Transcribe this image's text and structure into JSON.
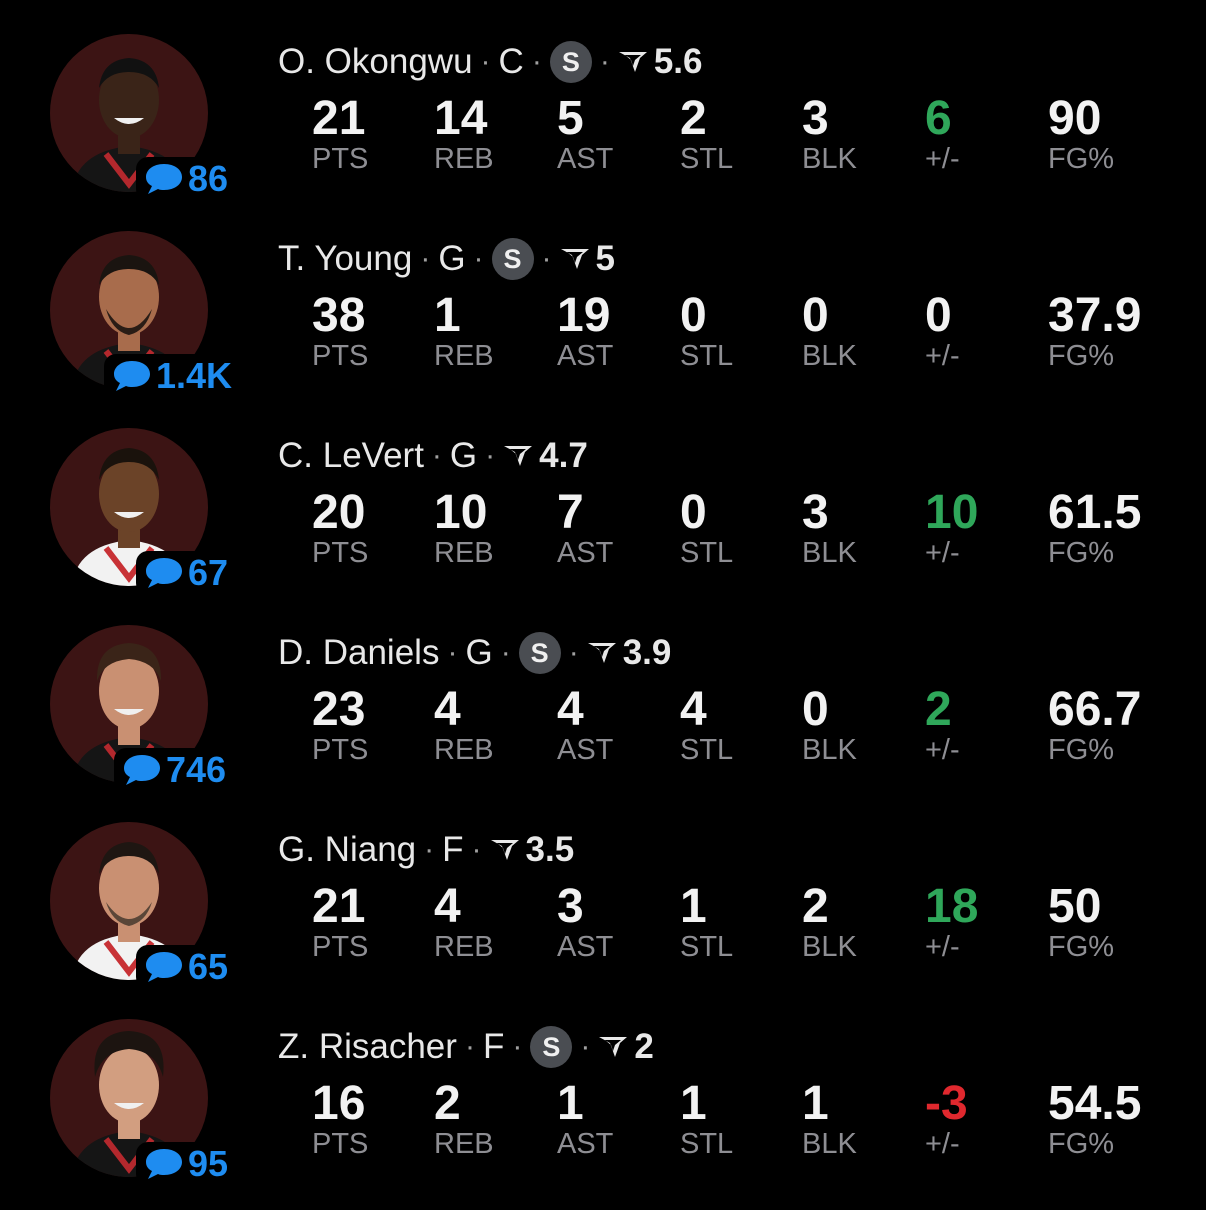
{
  "colors": {
    "background": "#000000",
    "comment_blue": "#1e8cf0",
    "plus_minus_positive": "#2fa75a",
    "plus_minus_negative": "#e0282e",
    "label_gray": "#8e8e93",
    "avatar_bg": "#3c1414",
    "starter_badge_bg": "#4a4d52"
  },
  "icons": {
    "comment": "chat-bubble-icon",
    "starter": "starter-badge-icon",
    "rating": "rating-logo-icon",
    "avatar": "player-headshot"
  },
  "separator": "·",
  "labels": {
    "pts": "PTS",
    "reb": "REB",
    "ast": "AST",
    "stl": "STL",
    "blk": "BLK",
    "pm": "+/-",
    "fg": "FG%"
  },
  "starter_badge_text": "S",
  "players": [
    {
      "name": "O. Okongwu",
      "position": "C",
      "starter": true,
      "rating": "5.6",
      "comments": "86",
      "stats": {
        "pts": "21",
        "reb": "14",
        "ast": "5",
        "stl": "2",
        "blk": "3",
        "pm": "6",
        "fg": "90"
      },
      "pm_sign": "positive"
    },
    {
      "name": "T. Young",
      "position": "G",
      "starter": true,
      "rating": "5",
      "comments": "1.4K",
      "stats": {
        "pts": "38",
        "reb": "1",
        "ast": "19",
        "stl": "0",
        "blk": "0",
        "pm": "0",
        "fg": "37.9"
      },
      "pm_sign": "neutral"
    },
    {
      "name": "C. LeVert",
      "position": "G",
      "starter": false,
      "rating": "4.7",
      "comments": "67",
      "stats": {
        "pts": "20",
        "reb": "10",
        "ast": "7",
        "stl": "0",
        "blk": "3",
        "pm": "10",
        "fg": "61.5"
      },
      "pm_sign": "positive"
    },
    {
      "name": "D. Daniels",
      "position": "G",
      "starter": true,
      "rating": "3.9",
      "comments": "746",
      "stats": {
        "pts": "23",
        "reb": "4",
        "ast": "4",
        "stl": "4",
        "blk": "0",
        "pm": "2",
        "fg": "66.7"
      },
      "pm_sign": "positive"
    },
    {
      "name": "G. Niang",
      "position": "F",
      "starter": false,
      "rating": "3.5",
      "comments": "65",
      "stats": {
        "pts": "21",
        "reb": "4",
        "ast": "3",
        "stl": "1",
        "blk": "2",
        "pm": "18",
        "fg": "50"
      },
      "pm_sign": "positive"
    },
    {
      "name": "Z. Risacher",
      "position": "F",
      "starter": true,
      "rating": "2",
      "comments": "95",
      "stats": {
        "pts": "16",
        "reb": "2",
        "ast": "1",
        "stl": "1",
        "blk": "1",
        "pm": "-3",
        "fg": "54.5"
      },
      "pm_sign": "negative"
    }
  ]
}
